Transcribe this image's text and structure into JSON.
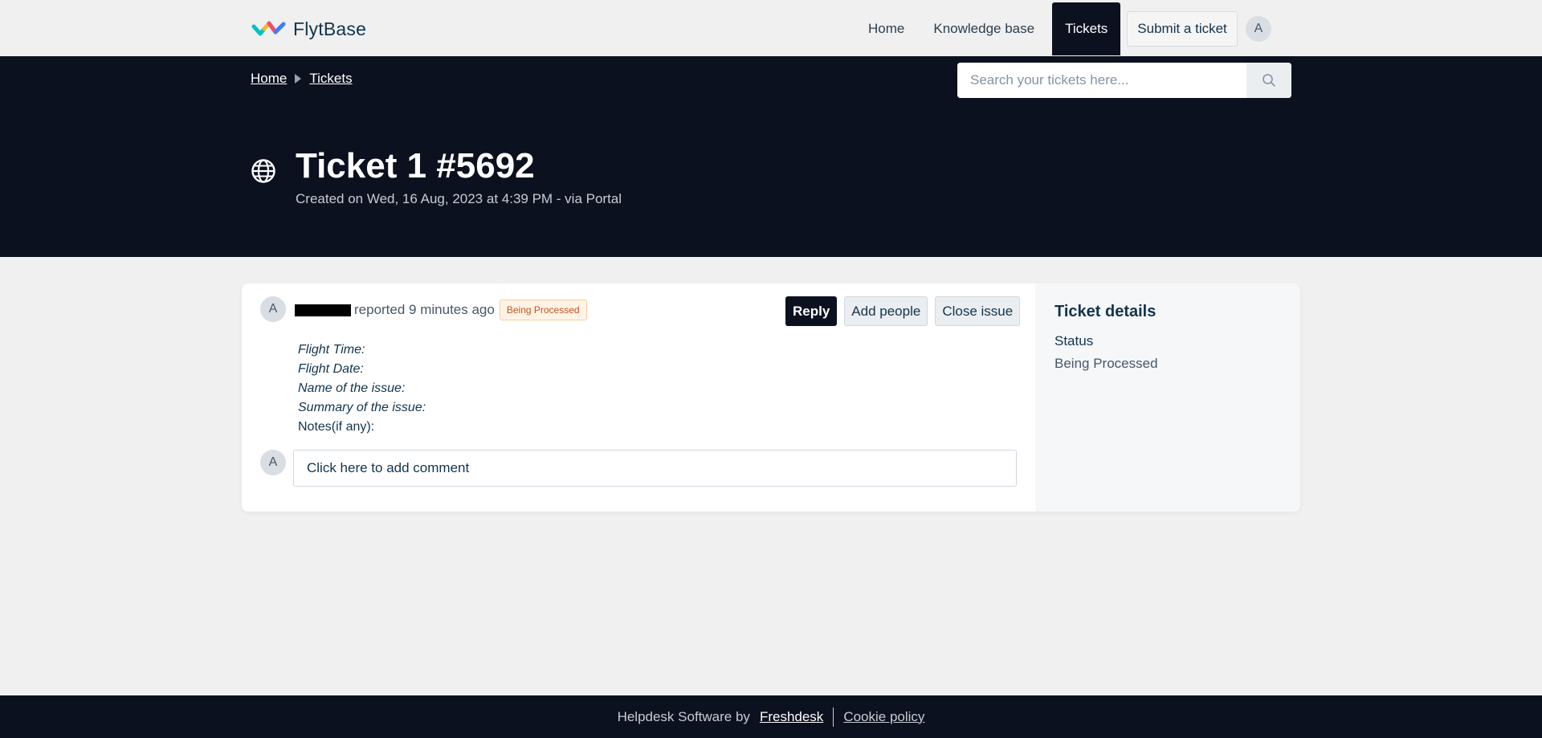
{
  "brand": {
    "name": "FlytBase"
  },
  "nav": {
    "items": [
      {
        "label": "Home"
      },
      {
        "label": "Knowledge base"
      },
      {
        "label": "Tickets",
        "active": true
      }
    ],
    "submit_label": "Submit a ticket",
    "avatar_initial": "A"
  },
  "breadcrumb": {
    "items": [
      {
        "label": "Home"
      },
      {
        "label": "Tickets"
      }
    ]
  },
  "search": {
    "placeholder": "Search your tickets here...",
    "value": ""
  },
  "ticket": {
    "title": "Ticket 1 #5692",
    "subtitle": "Created on Wed, 16 Aug, 2023 at 4:39 PM - via Portal",
    "reporter_initial": "A",
    "reported_text": "reported 9 minutes ago",
    "status": "Being Processed",
    "actions": {
      "reply": "Reply",
      "add_people": "Add people",
      "close_issue": "Close issue"
    },
    "description_lines": [
      "Flight Time:",
      "Flight Date:",
      "Name of the issue:",
      "Summary of the issue:",
      "Notes(if any):"
    ],
    "comment_avatar_initial": "A",
    "comment_prompt": "Click here to add comment"
  },
  "details": {
    "title": "Ticket details",
    "status_label": "Status",
    "status_value": "Being Processed"
  },
  "footer": {
    "text": "Helpdesk Software by",
    "link": "Freshdesk",
    "cookie": "Cookie policy"
  },
  "colors": {
    "dark": "#0b111e",
    "background": "#f0f0f0",
    "badge_text": "#c0561d"
  }
}
